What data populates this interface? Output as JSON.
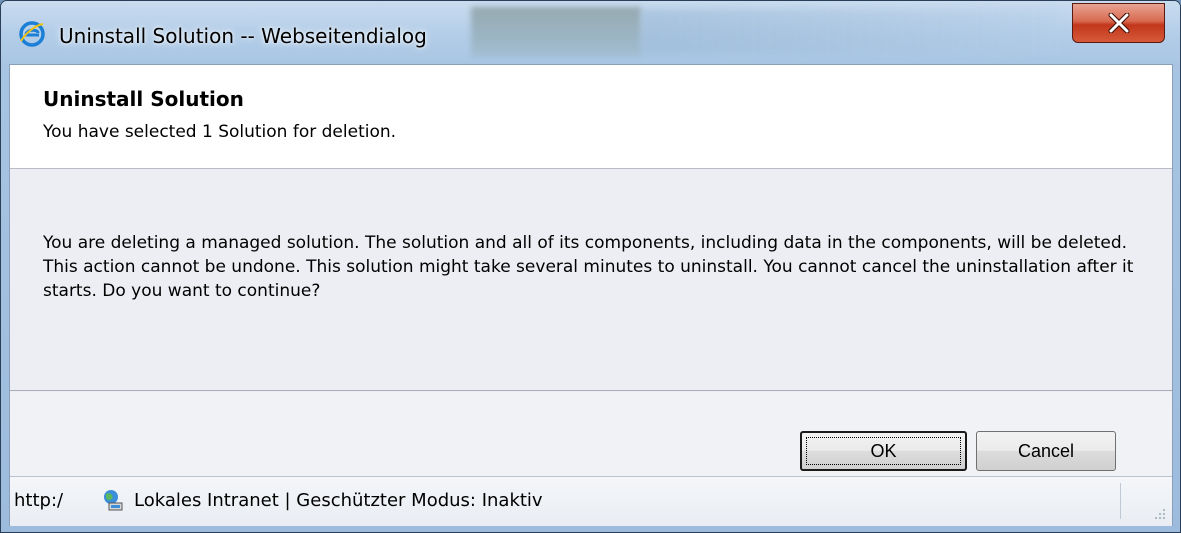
{
  "window": {
    "title": "Uninstall Solution -- Webseitendialog",
    "title_icon": "ie-icon",
    "close_icon": "close-icon"
  },
  "dialog": {
    "heading": "Uninstall Solution",
    "subheading": "You have selected 1 Solution for deletion.",
    "message": "You are deleting a managed solution. The solution and all of its components, including data in the components, will be deleted. This action cannot be undone. This solution might take several minutes to uninstall. You cannot cancel the uninstallation after it starts. Do you want to continue?"
  },
  "buttons": {
    "ok_label": "OK",
    "cancel_label": "Cancel"
  },
  "statusbar": {
    "url": "http:/",
    "zone_icon": "intranet-globe-icon",
    "zone_text": "Lokales Intranet | Geschützter Modus: Inaktiv"
  },
  "colors": {
    "close_red": "#c2371c",
    "header_bg": "#ffffff",
    "body_bg": "#eceef3",
    "frame_blue": "#a9c6e4"
  }
}
